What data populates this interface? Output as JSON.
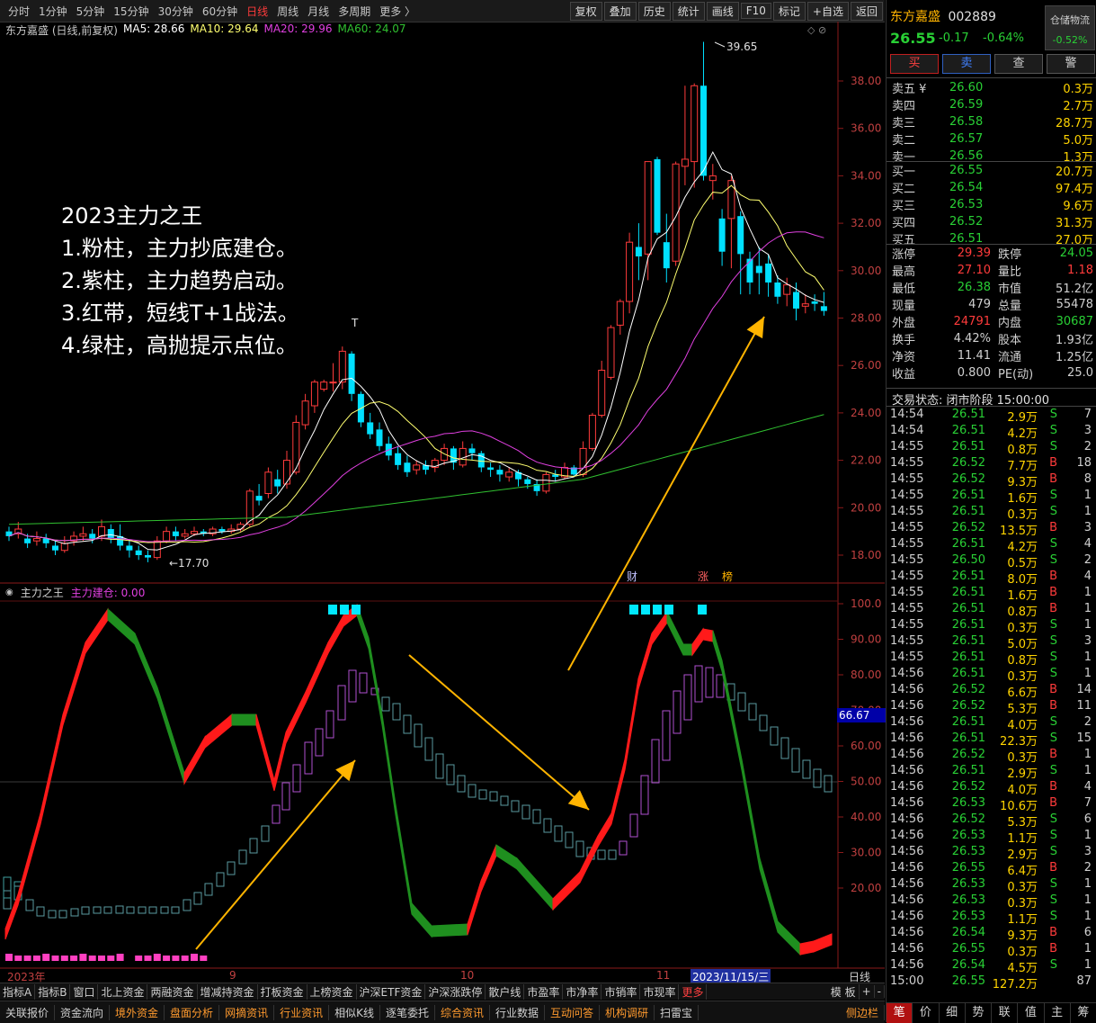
{
  "toolbar": {
    "periods": [
      "分时",
      "1分钟",
      "5分钟",
      "15分钟",
      "30分钟",
      "60分钟",
      "日线",
      "周线",
      "月线",
      "多周期",
      "更多 〉"
    ],
    "active_period": "日线",
    "right_buttons": [
      "复权",
      "叠加",
      "历史",
      "统计",
      "画线",
      "F10",
      "标记",
      "+自选",
      "返回"
    ]
  },
  "chart_header": {
    "title": "东方嘉盛 (日线,前复权)",
    "ma5": "MA5: 28.66",
    "ma10": "MA10: 29.64",
    "ma20": "MA20: 29.96",
    "ma60": "MA60: 24.07"
  },
  "commentary": [
    "2023主力之王",
    "1.粉柱，主力抄底建仓。",
    "2.紫柱，主力趋势启动。",
    "3.红带，短线T+1战法。",
    "4.绿柱，高抛提示点位。"
  ],
  "price_chart": {
    "y_labels": [
      "38.00",
      "36.00",
      "34.00",
      "32.00",
      "30.00",
      "28.00",
      "26.00",
      "24.00",
      "22.00",
      "20.00",
      "18.00"
    ],
    "y_values": [
      38,
      36,
      34,
      32,
      30,
      28,
      26,
      24,
      22,
      20,
      18
    ],
    "high_label": "39.65",
    "low_label": "←17.70",
    "t_marker": "T",
    "event_labels": [
      "财",
      "涨",
      "榜"
    ],
    "colors": {
      "up": "#ff3b3b",
      "down": "#00e0ff",
      "ma5": "#ffffff",
      "ma10": "#ffff70",
      "ma20": "#e040e0",
      "ma60": "#30c030"
    }
  },
  "indicator": {
    "title": "主力之王",
    "sub_label": "主力建仓: 0.00",
    "y_labels": [
      "100.0",
      "90.00",
      "80.00",
      "70.00",
      "60.00",
      "50.00",
      "40.00",
      "30.00",
      "20.00"
    ],
    "y_values": [
      100,
      90,
      80,
      70,
      60,
      50,
      40,
      30,
      20
    ],
    "current_value": "66.67"
  },
  "date_axis": {
    "labels": [
      "2023年",
      "9",
      "10",
      "11"
    ],
    "highlight": "2023/11/15/三",
    "period_label": "日线"
  },
  "bottom_tabs_row1": [
    "指标A",
    "指标B",
    "窗口",
    "北上资金",
    "两融资金",
    "增减持资金",
    "打板资金",
    "上榜资金",
    "沪深ETF资金",
    "沪深涨跌停",
    "散户线",
    "市盈率",
    "市净率",
    "市销率",
    "市现率",
    "更多"
  ],
  "bottom_tabs_row1_right": [
    "模 板",
    "+",
    "-"
  ],
  "bottom_tabs_row2": [
    "关联报价",
    "资金流向",
    "境外资金",
    "盘面分析",
    "网摘资讯",
    "行业资讯",
    "相似K线",
    "逐笔委托",
    "综合资讯",
    "行业数据",
    "互动问答",
    "机构调研",
    "扫雷宝"
  ],
  "bottom_tabs_row2_right": "侧边栏",
  "stock": {
    "name": "东方嘉盛",
    "code": "002889",
    "price": "26.55",
    "change": "-0.17",
    "change_pct": "-0.64%",
    "hold_label": "仓储物流",
    "hold_value": "-0.52%",
    "buttons": [
      "买",
      "卖",
      "查",
      "警"
    ]
  },
  "order_book": {
    "asks": [
      {
        "label": "卖五 ¥",
        "price": "26.60",
        "vol": "0.3万"
      },
      {
        "label": "卖四",
        "price": "26.59",
        "vol": "2.7万"
      },
      {
        "label": "卖三",
        "price": "26.58",
        "vol": "28.7万"
      },
      {
        "label": "卖二",
        "price": "26.57",
        "vol": "5.0万"
      },
      {
        "label": "卖一",
        "price": "26.56",
        "vol": "1.3万"
      }
    ],
    "bids": [
      {
        "label": "买一",
        "price": "26.55",
        "vol": "20.7万"
      },
      {
        "label": "买二",
        "price": "26.54",
        "vol": "97.4万"
      },
      {
        "label": "买三",
        "price": "26.53",
        "vol": "9.6万"
      },
      {
        "label": "买四",
        "price": "26.52",
        "vol": "31.3万"
      },
      {
        "label": "买五",
        "price": "26.51",
        "vol": "27.0万"
      }
    ]
  },
  "stats": [
    {
      "k1": "涨停",
      "v1": "29.39",
      "c1": "r",
      "k2": "跌停",
      "v2": "24.05",
      "c2": "g"
    },
    {
      "k1": "最高",
      "v1": "27.10",
      "c1": "r",
      "k2": "量比",
      "v2": "1.18",
      "c2": "r"
    },
    {
      "k1": "最低",
      "v1": "26.38",
      "c1": "g",
      "k2": "市值",
      "v2": "51.2亿",
      "c2": "w"
    },
    {
      "k1": "现量",
      "v1": "479",
      "c1": "w",
      "k2": "总量",
      "v2": "55478",
      "c2": "w"
    },
    {
      "k1": "外盘",
      "v1": "24791",
      "c1": "r",
      "k2": "内盘",
      "v2": "30687",
      "c2": "g"
    },
    {
      "k1": "换手",
      "v1": "4.42%",
      "c1": "w",
      "k2": "股本",
      "v2": "1.93亿",
      "c2": "w"
    },
    {
      "k1": "净资",
      "v1": "11.41",
      "c1": "w",
      "k2": "流通",
      "v2": "1.25亿",
      "c2": "w"
    },
    {
      "k1": "收益",
      "v1": "0.800",
      "c1": "w",
      "k2": "PE(动)",
      "v2": "25.0",
      "c2": "w"
    }
  ],
  "trade_status": "交易状态: 闭市阶段 15:00:00",
  "ticks": [
    {
      "t": "14:54",
      "p": "26.51",
      "v": "2.9万",
      "bs": "S",
      "n": "7"
    },
    {
      "t": "14:54",
      "p": "26.51",
      "v": "4.2万",
      "bs": "S",
      "n": "3"
    },
    {
      "t": "14:55",
      "p": "26.51",
      "v": "0.8万",
      "bs": "S",
      "n": "2"
    },
    {
      "t": "14:55",
      "p": "26.52",
      "v": "7.7万",
      "bs": "B",
      "n": "18"
    },
    {
      "t": "14:55",
      "p": "26.52",
      "v": "9.3万",
      "bs": "B",
      "n": "8"
    },
    {
      "t": "14:55",
      "p": "26.51",
      "v": "1.6万",
      "bs": "S",
      "n": "1"
    },
    {
      "t": "14:55",
      "p": "26.51",
      "v": "0.3万",
      "bs": "S",
      "n": "1"
    },
    {
      "t": "14:55",
      "p": "26.52",
      "v": "13.5万",
      "bs": "B",
      "n": "3"
    },
    {
      "t": "14:55",
      "p": "26.51",
      "v": "4.2万",
      "bs": "S",
      "n": "4"
    },
    {
      "t": "14:55",
      "p": "26.50",
      "v": "0.5万",
      "bs": "S",
      "n": "2"
    },
    {
      "t": "14:55",
      "p": "26.51",
      "v": "8.0万",
      "bs": "B",
      "n": "4"
    },
    {
      "t": "14:55",
      "p": "26.51",
      "v": "1.6万",
      "bs": "B",
      "n": "1"
    },
    {
      "t": "14:55",
      "p": "26.51",
      "v": "0.8万",
      "bs": "B",
      "n": "1"
    },
    {
      "t": "14:55",
      "p": "26.51",
      "v": "0.3万",
      "bs": "S",
      "n": "1"
    },
    {
      "t": "14:55",
      "p": "26.51",
      "v": "5.0万",
      "bs": "S",
      "n": "3"
    },
    {
      "t": "14:55",
      "p": "26.51",
      "v": "0.8万",
      "bs": "S",
      "n": "1"
    },
    {
      "t": "14:56",
      "p": "26.51",
      "v": "0.3万",
      "bs": "S",
      "n": "1"
    },
    {
      "t": "14:56",
      "p": "26.52",
      "v": "6.6万",
      "bs": "B",
      "n": "14"
    },
    {
      "t": "14:56",
      "p": "26.52",
      "v": "5.3万",
      "bs": "B",
      "n": "11"
    },
    {
      "t": "14:56",
      "p": "26.51",
      "v": "4.0万",
      "bs": "S",
      "n": "2"
    },
    {
      "t": "14:56",
      "p": "26.51",
      "v": "22.3万",
      "bs": "S",
      "n": "15"
    },
    {
      "t": "14:56",
      "p": "26.52",
      "v": "0.3万",
      "bs": "B",
      "n": "1"
    },
    {
      "t": "14:56",
      "p": "26.51",
      "v": "2.9万",
      "bs": "S",
      "n": "1"
    },
    {
      "t": "14:56",
      "p": "26.52",
      "v": "4.0万",
      "bs": "B",
      "n": "4"
    },
    {
      "t": "14:56",
      "p": "26.53",
      "v": "10.6万",
      "bs": "B",
      "n": "7"
    },
    {
      "t": "14:56",
      "p": "26.52",
      "v": "5.3万",
      "bs": "S",
      "n": "6"
    },
    {
      "t": "14:56",
      "p": "26.53",
      "v": "1.1万",
      "bs": "S",
      "n": "1"
    },
    {
      "t": "14:56",
      "p": "26.53",
      "v": "2.9万",
      "bs": "S",
      "n": "3"
    },
    {
      "t": "14:56",
      "p": "26.55",
      "v": "6.4万",
      "bs": "B",
      "n": "2"
    },
    {
      "t": "14:56",
      "p": "26.53",
      "v": "0.3万",
      "bs": "S",
      "n": "1"
    },
    {
      "t": "14:56",
      "p": "26.53",
      "v": "0.3万",
      "bs": "S",
      "n": "1"
    },
    {
      "t": "14:56",
      "p": "26.53",
      "v": "1.1万",
      "bs": "S",
      "n": "1"
    },
    {
      "t": "14:56",
      "p": "26.54",
      "v": "9.3万",
      "bs": "B",
      "n": "6"
    },
    {
      "t": "14:56",
      "p": "26.55",
      "v": "0.3万",
      "bs": "B",
      "n": "1"
    },
    {
      "t": "14:56",
      "p": "26.54",
      "v": "4.5万",
      "bs": "S",
      "n": "1"
    },
    {
      "t": "15:00",
      "p": "26.55",
      "v": "127.2万",
      "bs": "",
      "n": "87"
    }
  ],
  "right_bottom_tabs": [
    "笔",
    "价",
    "细",
    "势",
    "联",
    "值",
    "主",
    "筹"
  ]
}
